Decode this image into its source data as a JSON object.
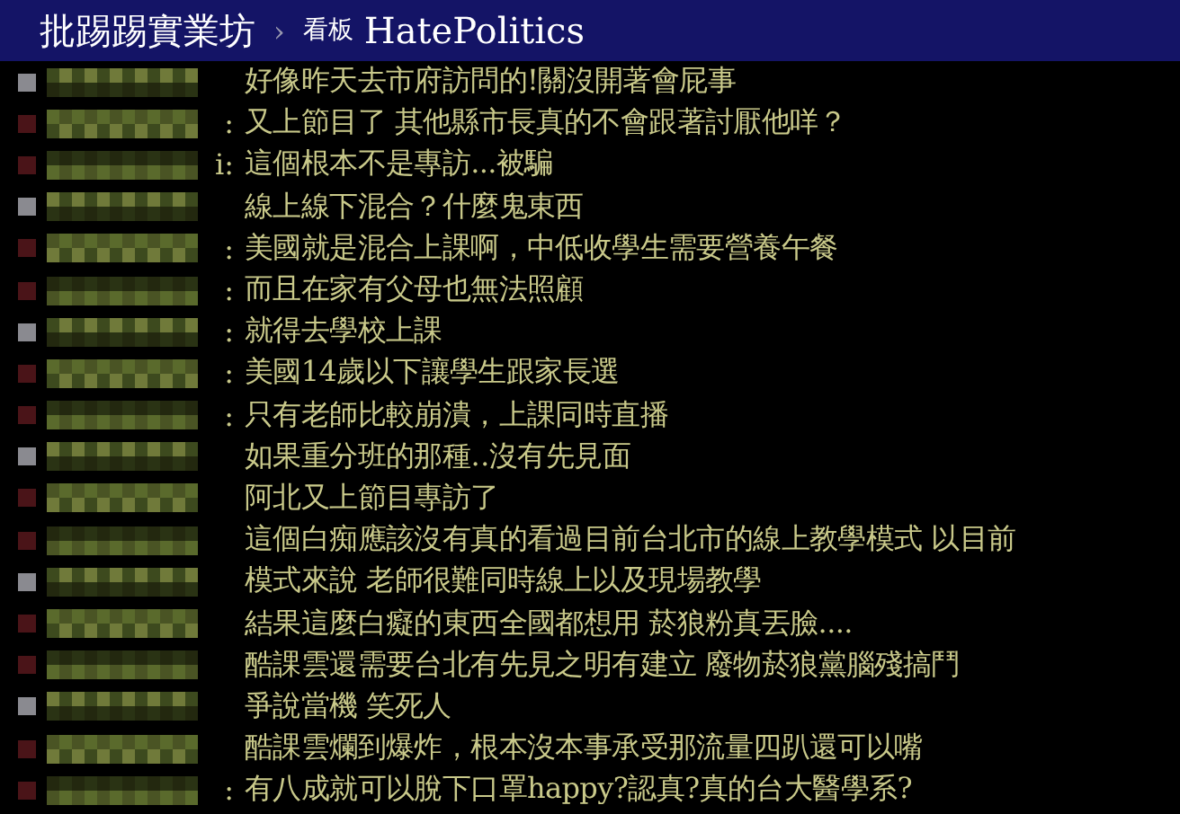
{
  "header": {
    "site": "批踢踢實業坊",
    "separator": "›",
    "board_label": "看板",
    "board": "HatePolitics"
  },
  "comments": [
    {
      "text": "好像昨天去市府訪問的!關沒開著會屁事"
    },
    {
      "prefix": ":",
      "text": "又上節目了 其他縣市長真的不會跟著討厭他咩？"
    },
    {
      "prefix": "i:",
      "text": "這個根本不是專訪...被騙"
    },
    {
      "text": "線上線下混合？什麼鬼東西"
    },
    {
      "prefix": ":",
      "text": "美國就是混合上課啊，中低收學生需要營養午餐"
    },
    {
      "prefix": ":",
      "text": "而且在家有父母也無法照顧"
    },
    {
      "prefix": ":",
      "text": "就得去學校上課"
    },
    {
      "prefix": ":",
      "text": "美國14歲以下讓學生跟家長選"
    },
    {
      "prefix": ":",
      "text": "只有老師比較崩潰，上課同時直播"
    },
    {
      "text": "如果重分班的那種‥沒有先見面"
    },
    {
      "text": "阿北又上節目專訪了"
    },
    {
      "text": "這個白痴應該沒有真的看過目前台北市的線上教學模式 以目前"
    },
    {
      "text": "模式來說 老師很難同時線上以及現場教學"
    },
    {
      "text": "結果這麼白癡的東西全國都想用 菸狼粉真丟臉...."
    },
    {
      "text": "酷課雲還需要台北有先見之明有建立 廢物菸狼黨腦殘搞鬥"
    },
    {
      "text": "爭說當機 笑死人"
    },
    {
      "text": "酷課雲爛到爆炸，根本沒本事承受那流量四趴還可以嘴"
    },
    {
      "prefix": ":",
      "text": "有八成就可以脫下口罩happy?認真?真的台大醫學系?"
    }
  ]
}
